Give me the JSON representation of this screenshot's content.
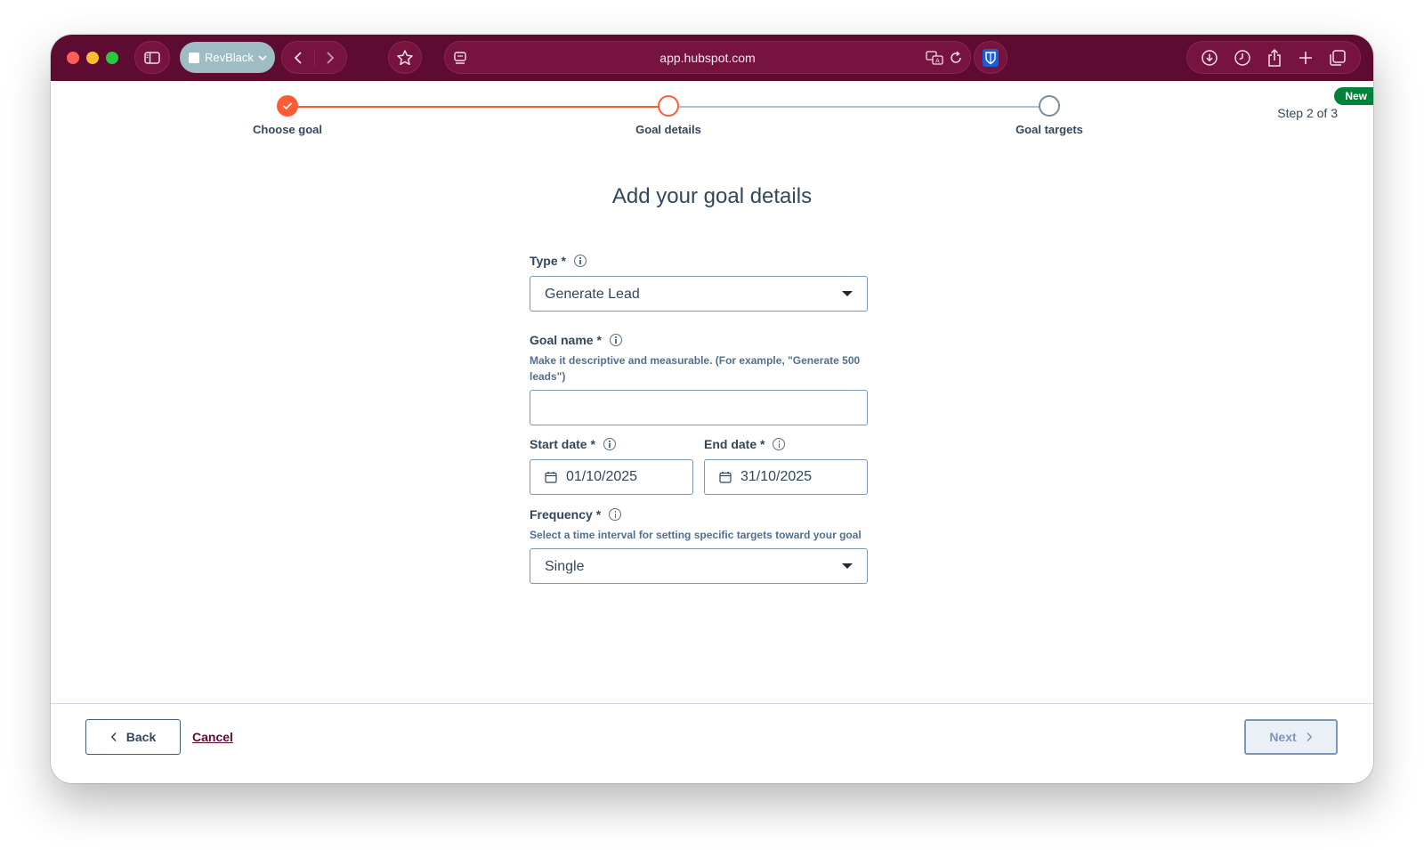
{
  "browser": {
    "profile_name": "RevBlack",
    "url": "app.hubspot.com"
  },
  "stepper": {
    "steps": [
      {
        "label": "Choose goal",
        "state": "complete"
      },
      {
        "label": "Goal details",
        "state": "current"
      },
      {
        "label": "Goal targets",
        "state": "pending"
      }
    ],
    "step_count": "Step 2 of 3",
    "badge": "New"
  },
  "form": {
    "title": "Add your goal details",
    "type": {
      "label": "Type *",
      "value": "Generate Lead"
    },
    "goal_name": {
      "label": "Goal name *",
      "help": "Make it descriptive and measurable. (For example, \"Generate 500 leads\")",
      "value": ""
    },
    "start_date": {
      "label": "Start date *",
      "value": "01/10/2025"
    },
    "end_date": {
      "label": "End date *",
      "value": "31/10/2025"
    },
    "frequency": {
      "label": "Frequency *",
      "help": "Select a time interval for setting specific targets toward your goal",
      "value": "Single"
    }
  },
  "footer": {
    "back_label": "Back",
    "cancel_label": "Cancel",
    "next_label": "Next"
  },
  "colors": {
    "browser_chrome": "#5e0b32",
    "accent": "#ff5c35",
    "text": "#33475b",
    "new_badge": "#00823a"
  }
}
